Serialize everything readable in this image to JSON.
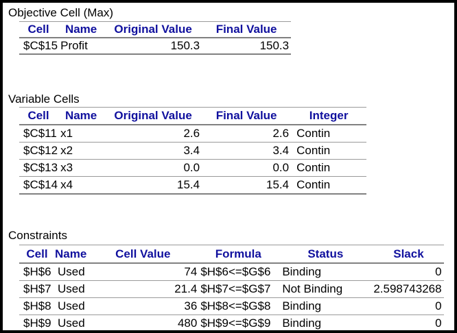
{
  "report": {
    "colors": {
      "header_text": "#10109e",
      "grid_line": "#8c8c8c",
      "body_text": "#000000",
      "outer_border": "#000000"
    },
    "objective": {
      "title": "Objective Cell (Max)",
      "headers": [
        "Cell",
        "Name",
        "Original Value",
        "Final Value"
      ],
      "rows": [
        [
          "$C$15",
          "Profit",
          "150.3",
          "150.3"
        ]
      ]
    },
    "variables": {
      "title": "Variable Cells",
      "headers": [
        "Cell",
        "Name",
        "Original Value",
        "Final Value",
        "Integer"
      ],
      "rows": [
        [
          "$C$11",
          "x1",
          "2.6",
          "2.6",
          "Contin"
        ],
        [
          "$C$12",
          "x2",
          "3.4",
          "3.4",
          "Contin"
        ],
        [
          "$C$13",
          "x3",
          "0.0",
          "0.0",
          "Contin"
        ],
        [
          "$C$14",
          "x4",
          "15.4",
          "15.4",
          "Contin"
        ]
      ]
    },
    "constraints": {
      "title": "Constraints",
      "headers": [
        "Cell",
        "Name",
        "Cell Value",
        "Formula",
        "Status",
        "Slack"
      ],
      "rows": [
        [
          "$H$6",
          "Used",
          "74",
          "$H$6<=$G$6",
          "Binding",
          "0"
        ],
        [
          "$H$7",
          "Used",
          "21.4",
          "$H$7<=$G$7",
          "Not Binding",
          "2.598743268"
        ],
        [
          "$H$8",
          "Used",
          "36",
          "$H$8<=$G$8",
          "Binding",
          "0"
        ],
        [
          "$H$9",
          "Used",
          "480",
          "$H$9<=$G$9",
          "Binding",
          "0"
        ]
      ]
    }
  }
}
